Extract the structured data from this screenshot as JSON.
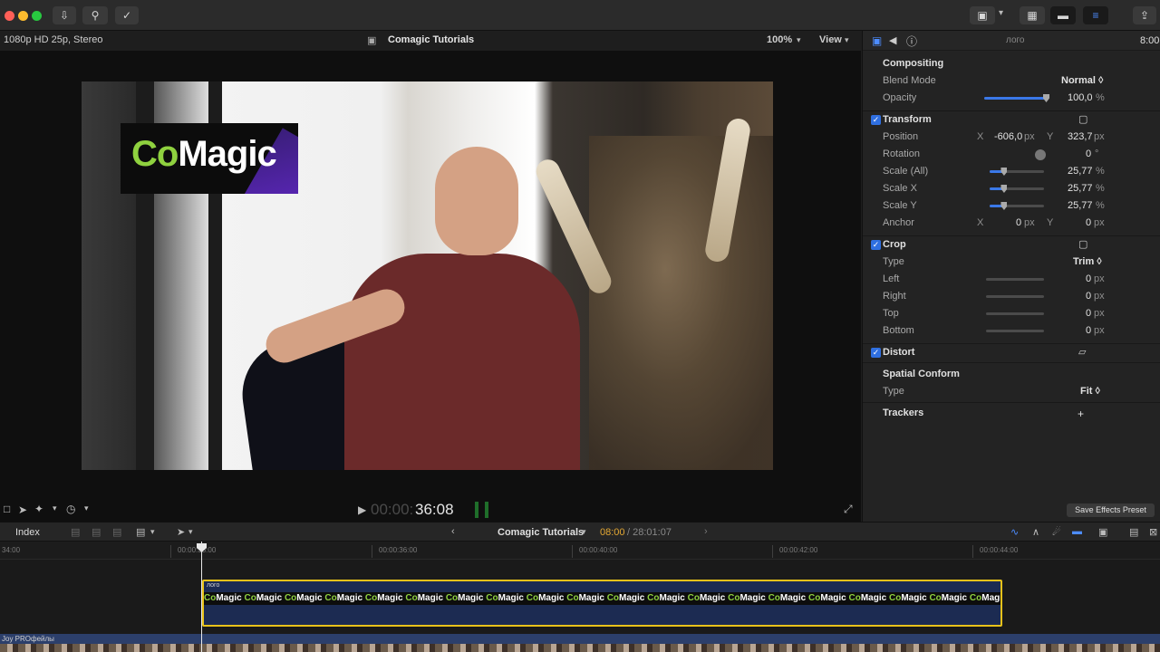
{
  "viewer": {
    "format": "1080p HD 25p, Stereo",
    "title": "Comagic Tutorials",
    "zoom": "100%",
    "view_label": "View",
    "timecode_dim": "00:00:",
    "timecode": "36:08"
  },
  "video": {
    "logo_co": "Co",
    "logo_magic": "Magic"
  },
  "inspector": {
    "clip_name": "лого",
    "duration": "8:00",
    "compositing": "Compositing",
    "blend_mode_label": "Blend Mode",
    "blend_mode_value": "Normal ◊",
    "opacity_label": "Opacity",
    "opacity_value": "100,0",
    "opacity_unit": "%",
    "opacity_level": 1.0,
    "transform": "Transform",
    "position_label": "Position",
    "position_x_label": "X",
    "position_x": "-606,0",
    "position_y_label": "Y",
    "position_y": "323,7",
    "px": "px",
    "rotation_label": "Rotation",
    "rotation_value": "0",
    "rotation_unit": "°",
    "scale_all_label": "Scale (All)",
    "scale_all_value": "25,77",
    "scale_x_label": "Scale X",
    "scale_x_value": "25,77",
    "scale_y_label": "Scale Y",
    "scale_y_value": "25,77",
    "scale_level": 0.2577,
    "anchor_label": "Anchor",
    "anchor_x_label": "X",
    "anchor_x": "0",
    "anchor_y_label": "Y",
    "anchor_y": "0",
    "crop": "Crop",
    "crop_type_label": "Type",
    "crop_type_value": "Trim ◊",
    "left_label": "Left",
    "right_label": "Right",
    "top_label": "Top",
    "bottom_label": "Bottom",
    "crop_zero": "0",
    "distort": "Distort",
    "spatial_conform": "Spatial Conform",
    "sc_type_label": "Type",
    "sc_type_value": "Fit ◊",
    "trackers": "Trackers",
    "trackers_add": "+",
    "percent": "%",
    "save_preset": "Save Effects Preset"
  },
  "timeline": {
    "index_label": "Index",
    "project_name": "Comagic Tutorials",
    "position": "08:00",
    "duration": "/ 28:01:07",
    "ruler": [
      "34:00",
      "00:00:38:00",
      "00:00:36:00",
      "00:00:40:00",
      "00:00:42:00",
      "00:00:44:00"
    ],
    "logo_clip_name": "лого",
    "main_clip_name": "Joy PROфейлы",
    "logo_strip_co": "Co",
    "logo_strip_magic": "Magic"
  },
  "colors": {
    "accent": "#3a78e8",
    "selection": "#e8c21a",
    "logo_green": "#8fd13f"
  }
}
